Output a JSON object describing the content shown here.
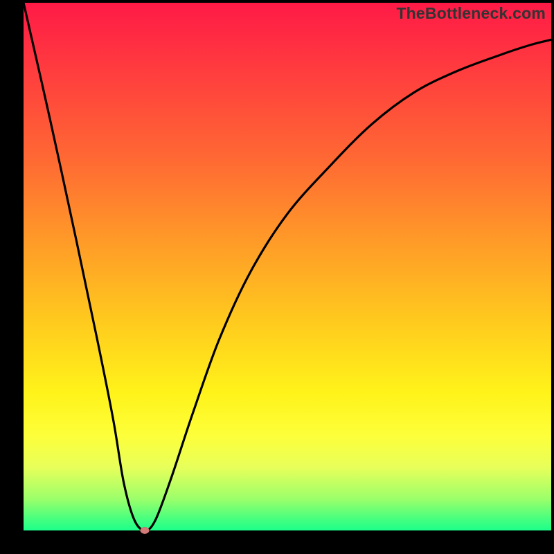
{
  "watermark": "TheBottleneck.com",
  "colors": {
    "frame": "#000000",
    "curve": "#000000",
    "marker": "#d47a78",
    "gradient_top": "#ff1a46",
    "gradient_mid": "#fff31a",
    "gradient_bottom": "#1cff8a"
  },
  "chart_data": {
    "type": "line",
    "title": "",
    "xlabel": "",
    "ylabel": "",
    "xlim": [
      0,
      100
    ],
    "ylim": [
      0,
      100
    ],
    "grid": false,
    "legend": false,
    "series": [
      {
        "name": "bottleneck-curve",
        "x": [
          0,
          5,
          10,
          14,
          17,
          19,
          21,
          23,
          25,
          28,
          32,
          37,
          43,
          50,
          58,
          66,
          74,
          82,
          90,
          96,
          100
        ],
        "y": [
          100,
          78,
          55,
          36,
          21,
          9,
          2,
          0,
          2,
          10,
          22,
          36,
          49,
          60,
          69,
          77,
          83,
          87,
          90,
          92,
          93
        ]
      }
    ],
    "annotations": [
      {
        "name": "minimum-marker",
        "x": 23,
        "y": 0
      }
    ]
  }
}
